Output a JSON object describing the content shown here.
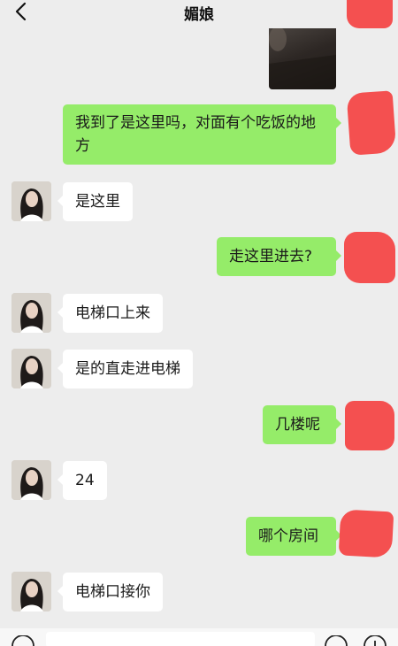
{
  "header": {
    "title": "媚娘"
  },
  "messages": [
    {
      "side": "out",
      "text": "我到了是这里吗，对面有个吃饭的地方"
    },
    {
      "side": "in",
      "text": "是这里"
    },
    {
      "side": "out",
      "text": "走这里进去?"
    },
    {
      "side": "in",
      "text": "电梯口上来"
    },
    {
      "side": "in",
      "text": "是的直走进电梯"
    },
    {
      "side": "out",
      "text": "几楼呢"
    },
    {
      "side": "in",
      "text": "24"
    },
    {
      "side": "out",
      "text": "哪个房间"
    },
    {
      "side": "in",
      "text": "电梯口接你"
    }
  ],
  "colors": {
    "background": "#ededed",
    "outgoing_bubble": "#95ec69",
    "incoming_bubble": "#ffffff",
    "redaction": "#f45050"
  },
  "icons": [
    "back-arrow-icon",
    "more-dots-icon",
    "voice-icon",
    "emoji-icon",
    "plus-icon"
  ]
}
